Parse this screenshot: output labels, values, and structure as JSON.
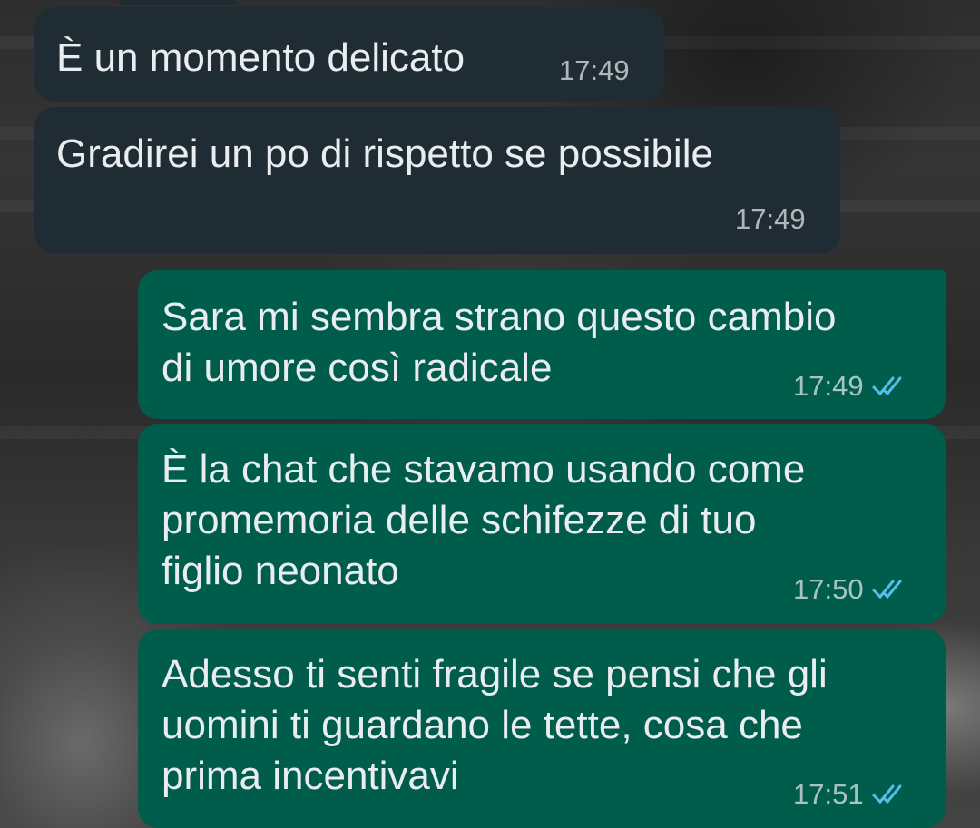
{
  "chat": {
    "messages": [
      {
        "direction": "incoming",
        "text": "È un momento delicato",
        "time": "17:49"
      },
      {
        "direction": "incoming",
        "text": "Gradirei un po di rispetto se possibile",
        "time": "17:49"
      },
      {
        "direction": "outgoing",
        "text": "Sara mi sembra strano questo cambio\ndi umore così radicale",
        "time": "17:49",
        "status": "read"
      },
      {
        "direction": "outgoing",
        "text": "È la chat che stavamo usando come\npromemoria delle schifezze di tuo\nfiglio neonato",
        "time": "17:50",
        "status": "read"
      },
      {
        "direction": "outgoing",
        "text": "Adesso ti senti fragile se pensi che gli\nuomini ti guardano le tette, cosa che\nprima incentivavi",
        "time": "17:51",
        "status": "read"
      }
    ]
  },
  "icons": {
    "read_receipt": "double-check-icon"
  },
  "colors": {
    "incoming_bubble": "#1f2c34",
    "outgoing_bubble": "#005c4b",
    "read_tick": "#53bdeb",
    "message_text": "#e9edef"
  }
}
